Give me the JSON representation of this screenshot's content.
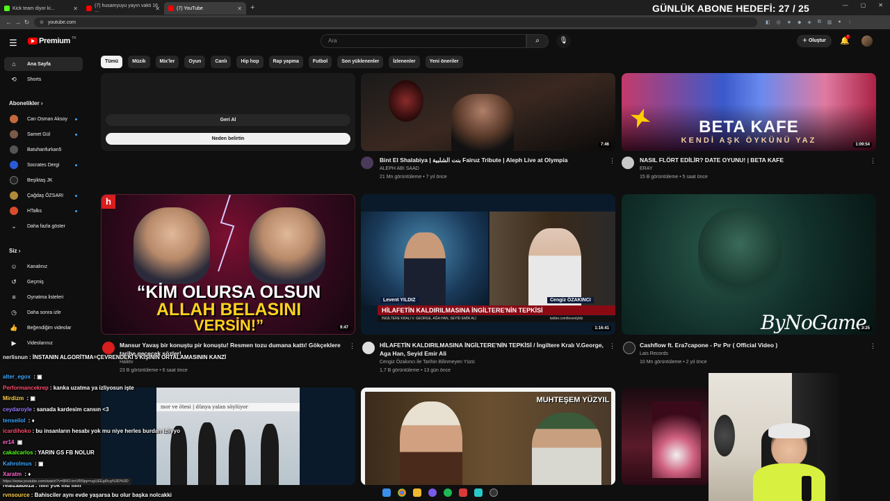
{
  "browser": {
    "tabs": [
      {
        "label": "Kick team diyor ki...",
        "color": "#53fc18"
      },
      {
        "label": "(7) husamyuyu yayın vakti 16 ...",
        "color": "#ff0000"
      },
      {
        "label": "(7) YouTube",
        "color": "#ff0000"
      }
    ],
    "url": "youtube.com",
    "status_url": "https://www.youtube.com/watch?v=8RO-lmVR6lpp=ugUEEgl0cg%3D%3D"
  },
  "overlay": {
    "goal_text": "GÜNLÜK ABONE HEDEFİ: 27 / 25"
  },
  "youtube": {
    "logo_text": "Premium",
    "logo_sup": "TR",
    "search_placeholder": "Ara",
    "create_label": "Oluştur",
    "notif_count": "7",
    "chips": [
      "Tümü",
      "Müzik",
      "Mix'ler",
      "Oyun",
      "Canlı",
      "Hip hop",
      "Rap yapma",
      "Futbol",
      "Son yüklenenler",
      "İzlenenler",
      "Yeni öneriler"
    ]
  },
  "sidebar": {
    "home": "Ana Sayfa",
    "shorts": "Shorts",
    "subs_header": "Abonelikler",
    "subscriptions": [
      {
        "name": "Can Osman Aksoy",
        "color": "#c46a3a"
      },
      {
        "name": "Samet Gül",
        "color": "#7a5a4a"
      },
      {
        "name": "Batuhanfurkan5",
        "color": "#555555"
      },
      {
        "name": "Socrates Dergi",
        "color": "#2a5bd7"
      },
      {
        "name": "Beşiktaş JK",
        "color": "#222222"
      },
      {
        "name": "Çağdaş ÖZSARI",
        "color": "#b08a3a"
      },
      {
        "name": "HTalks",
        "color": "#d94b2a"
      }
    ],
    "show_more": "Daha fazla göster",
    "you_header": "Siz",
    "you_items": [
      "Kanalınız",
      "Geçmiş",
      "Oynatma listeleri",
      "Daha sonra izle",
      "Beğendiğim videolar",
      "Videolarınız"
    ]
  },
  "feedback_card": {
    "undo": "Geri Al",
    "why": "Neden belirtin"
  },
  "videos": [
    {
      "title": "Bint El Shalabiya | بنت الشلبية Fairuz Tribute | Aleph Live at Olympia",
      "channel": "ALEPH ABI SAAD",
      "meta": "21 Mn görüntüleme • 7 yıl önce",
      "duration": "7:46"
    },
    {
      "title": "NASIL FLÖRT EDİLİR? DATE OYUNU! | BETA KAFE",
      "channel": "ERAY",
      "meta": "15 B görüntüleme • 5 saat önce",
      "duration": "1:09:54",
      "thumb_title": "BETA KAFE",
      "thumb_sub": "KENDİ AŞK ÖYKÜNÜ YAZ"
    },
    {
      "title": "Mansur Yavaş bir konuştu pir konuştu! Resmen tozu dumana kattı! Gökçeklere",
      "title2": "tarihe geçecek sözler!",
      "channel": "Halktv",
      "meta": "23 B görüntüleme • 6 saat önce",
      "duration": "9:47",
      "thumb_line1": "“KİM OLURSA OLSUN",
      "thumb_line2": "ALLAH BELASINI",
      "thumb_line3": "VERSİN!”"
    },
    {
      "title": "HİLAFETİN KALDIRILMASINA İNGİLTERE'NİN TEPKİSİ / İngiltere Kralı V.George,",
      "title2": "Aga Han, Seyid Emir Ali",
      "channel": "Cengiz Özakıncı ile Tarihin Bilinmeyen Yüzü",
      "meta": "1,7 B görüntüleme • 13 gün önce",
      "duration": "1:16:41",
      "name_left": "Levent YILDIZ",
      "name_right": "Cengiz ÖZAKINCI",
      "banner": "HİLAFETİN KALDIRILMASINA İNGİLTERE'NİN TEPKİSİ",
      "banner_sub": "İNGİLTERE KRALI V. GEORGE, AĞA HAN, SEYİD EMİR ALİ",
      "banner_handle": "twitter.com/leventyldz"
    },
    {
      "title": "Cashflow ft. Era7capone - Pır Pır ( Official Video )",
      "channel": "Lais Records",
      "meta": "10 Mn görüntüleme • 2 yıl önce",
      "duration": "3:25"
    },
    {
      "thumb_caption": "mor ve ötesi | dünya yalan söylüyor"
    },
    {
      "thumb_caption": "MUHTEŞEM YÜZYIL"
    }
  ],
  "chat": [
    {
      "user": "nerlisnun",
      "text": "İNSTANIN ALGORİTMA=ÇEVRENDEKİ 5 KİŞİNİN ORTALAMASININ KANZİ",
      "color": "#e8e8e8"
    },
    {
      "user": "alter_egox",
      "text": ":",
      "color": "#3ea6ff"
    },
    {
      "user": "Performancekrep",
      "text": "kanka uzatma ya izliyosun işte",
      "color": "#ff4d6d"
    },
    {
      "user": "Mirdizm",
      "text": ":",
      "color": "#ffd24d"
    },
    {
      "user": "ceydaroyle",
      "text": "sanada kardesim cansın <3",
      "color": "#9b7bff"
    },
    {
      "user": "tenseilol",
      "text": ":",
      "color": "#3ea6ff"
    },
    {
      "user": "icardihoko",
      "text": "bu insanların hesabı yok mu niye herles burdan izliyyo",
      "color": "#ff4d6d"
    },
    {
      "user": "er14",
      "text": "",
      "color": "#ff66cc"
    },
    {
      "user": "cakalcarlos",
      "text": "YARIN GS FB NOLUR",
      "color": "#53fc18"
    },
    {
      "user": "Kahrolmus",
      "text": ":",
      "color": "#3ea6ff"
    },
    {
      "user": "Xaratm",
      "text": ":",
      "color": "#ff66cc"
    },
    {
      "user": "realzaadeza",
      "text": "film yok mu film",
      "color": "#ffffff"
    },
    {
      "user": "rvnsource",
      "text": "Bahisciler aynı evde yaşarsa bu olur başka nolcakki",
      "color": "#ffd24d"
    }
  ]
}
